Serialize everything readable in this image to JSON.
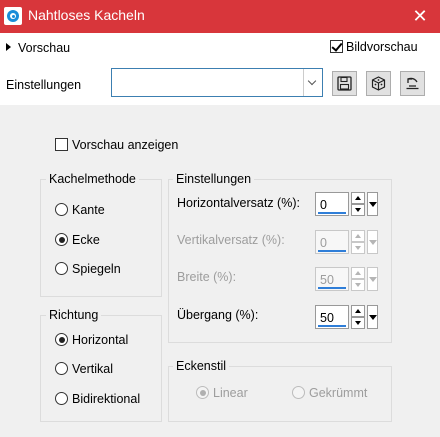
{
  "window": {
    "title": "Nahtloses Kacheln",
    "close_glyph": "✕",
    "titlebar_color": "#d8363b"
  },
  "top": {
    "preview_toggle": "Vorschau",
    "image_preview": {
      "label": "Bildvorschau",
      "checked": true
    },
    "settings_label": "Einstellungen",
    "preset_value": ""
  },
  "main": {
    "show_preview": {
      "label": "Vorschau anzeigen",
      "checked": false
    },
    "tile_method": {
      "title": "Kachelmethode",
      "options": [
        {
          "label": "Kante",
          "selected": false
        },
        {
          "label": "Ecke",
          "selected": true
        },
        {
          "label": "Spiegeln",
          "selected": false
        }
      ]
    },
    "direction": {
      "title": "Richtung",
      "options": [
        {
          "label": "Horizontal",
          "selected": true
        },
        {
          "label": "Vertikal",
          "selected": false
        },
        {
          "label": "Bidirektional",
          "selected": false
        }
      ]
    },
    "settings": {
      "title": "Einstellungen",
      "fields": [
        {
          "label": "Horizontalversatz (%):",
          "value": "0",
          "enabled": true
        },
        {
          "label": "Vertikalversatz (%):",
          "value": "0",
          "enabled": false
        },
        {
          "label": "Breite (%):",
          "value": "50",
          "enabled": false
        },
        {
          "label": "Übergang (%):",
          "value": "50",
          "enabled": true
        }
      ]
    },
    "corner_style": {
      "title": "Eckenstil",
      "options": [
        {
          "label": "Linear",
          "selected": true,
          "enabled": false
        },
        {
          "label": "Gekrümmt",
          "selected": false,
          "enabled": false
        }
      ]
    }
  }
}
